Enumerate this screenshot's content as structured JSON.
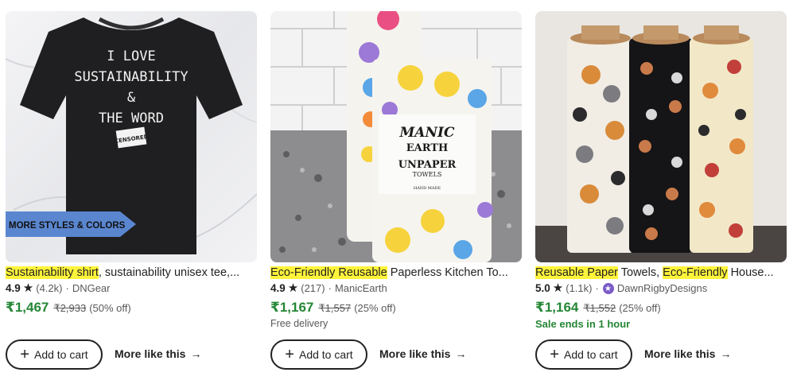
{
  "cards": [
    {
      "image": {
        "kind": "tshirt-photo",
        "shirt_text": [
          "I LOVE",
          "SUSTAINABILITY",
          "&",
          "THE WORD"
        ],
        "stamp_text": "CENSORED",
        "banner": "MORE STYLES  & COLORS"
      },
      "title_highlight_1": "Sustainability shirt",
      "title_plain_1": ", sustainability unisex tee,...",
      "rating": "4.9",
      "reviews": "(4.2k)",
      "separator": "·",
      "seller": "DNGear",
      "star_seller": false,
      "price": "₹1,467",
      "original_price": "₹2,933",
      "discount": "(50% off)",
      "extra": "",
      "add_to_cart": "Add to cart",
      "more_like_this": "More like this"
    },
    {
      "image": {
        "kind": "paper-towel-photo",
        "label_lines": [
          "MANIC",
          "EARTH",
          "UNPAPER",
          "TOWELS",
          "HAND MADE"
        ]
      },
      "title_highlight_1": "Eco-Friendly Reusable",
      "title_plain_1": " Paperless Kitchen To...",
      "rating": "4.9",
      "reviews": "(217)",
      "separator": "·",
      "seller": "ManicEarth",
      "star_seller": false,
      "price": "₹1,167",
      "original_price": "₹1,557",
      "discount": "(25% off)",
      "extra": "Free delivery",
      "add_to_cart": "Add to cart",
      "more_like_this": "More like this"
    },
    {
      "image": {
        "kind": "cat-towel-rolls-photo"
      },
      "title_highlight_1": "Reusable Paper",
      "title_plain_1": " Towels, ",
      "title_highlight_2": "Eco-Friendly",
      "title_plain_2": " House...",
      "rating": "5.0",
      "reviews": "(1.1k)",
      "separator": "·",
      "seller": "DawnRigbyDesigns",
      "star_seller": true,
      "price": "₹1,164",
      "original_price": "₹1,552",
      "discount": "(25% off)",
      "extra": "Sale ends in 1 hour",
      "add_to_cart": "Add to cart",
      "more_like_this": "More like this"
    }
  ],
  "colors": {
    "price": "#258635",
    "highlight": "#fff43a",
    "banner": "#5a86cf",
    "star_seller": "#7b5cc8"
  }
}
